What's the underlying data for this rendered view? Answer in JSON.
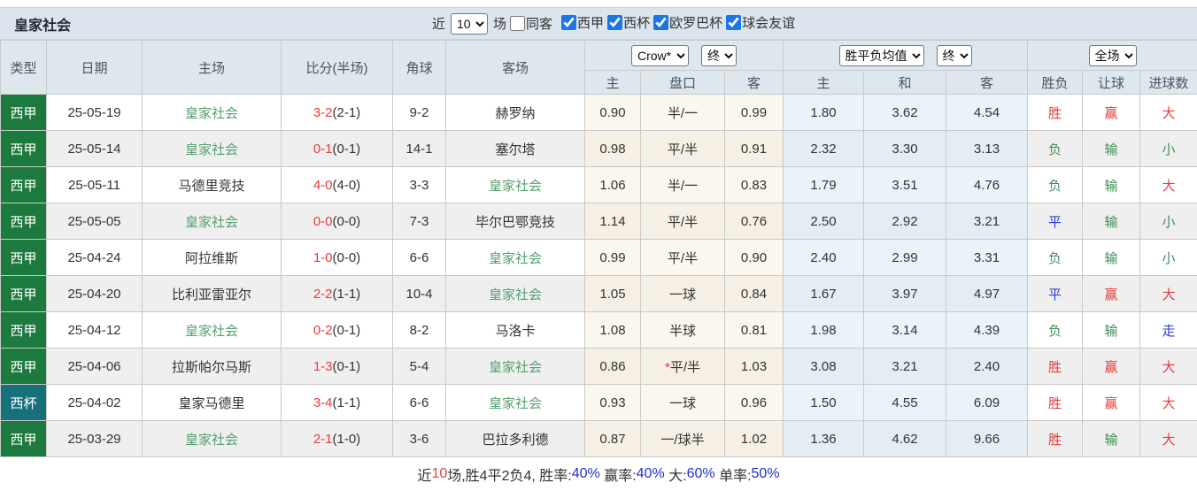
{
  "header": {
    "title": "皇家社会",
    "recent_label": "近",
    "recent_value": "10",
    "matches_label": "场",
    "same_venue_label": "同客",
    "leagues": [
      {
        "label": "西甲",
        "checked": true
      },
      {
        "label": "西杯",
        "checked": true
      },
      {
        "label": "欧罗巴杯",
        "checked": true
      },
      {
        "label": "球会友谊",
        "checked": true
      }
    ]
  },
  "table": {
    "columns": {
      "type": "类型",
      "date": "日期",
      "home": "主场",
      "score": "比分(半场)",
      "corner": "角球",
      "away": "客场"
    },
    "selects": {
      "bookmaker": "Crow*",
      "bookmaker_time": "终",
      "odds_mode": "胜平负均值",
      "odds_time": "终",
      "scope": "全场"
    },
    "sub_headers": {
      "ah_home": "主",
      "ah_line": "盘口",
      "ah_away": "客",
      "eu_home": "主",
      "eu_draw": "和",
      "eu_away": "客",
      "result": "胜负",
      "handicap": "让球",
      "goals": "进球数"
    },
    "rows": [
      {
        "league": "西甲",
        "comp": "liga",
        "date": "25-05-19",
        "home": "皇家社会",
        "home_hl": true,
        "score": "3-2",
        "half": "(2-1)",
        "corner": "9-2",
        "away": "赫罗纳",
        "away_hl": false,
        "ah": [
          "0.90",
          "半/一",
          "0.99"
        ],
        "star": false,
        "eu": [
          "1.80",
          "3.62",
          "4.54"
        ],
        "res": [
          "胜",
          "red"
        ],
        "hcp": [
          "赢",
          "red"
        ],
        "goal": [
          "大",
          "red"
        ]
      },
      {
        "league": "西甲",
        "comp": "liga",
        "date": "25-05-14",
        "home": "皇家社会",
        "home_hl": true,
        "score": "0-1",
        "half": "(0-1)",
        "corner": "14-1",
        "away": "塞尔塔",
        "away_hl": false,
        "ah": [
          "0.98",
          "平/半",
          "0.91"
        ],
        "star": false,
        "eu": [
          "2.32",
          "3.30",
          "3.13"
        ],
        "res": [
          "负",
          "green"
        ],
        "hcp": [
          "输",
          "green"
        ],
        "goal": [
          "小",
          "green"
        ]
      },
      {
        "league": "西甲",
        "comp": "liga",
        "date": "25-05-11",
        "home": "马德里竞技",
        "home_hl": false,
        "score": "4-0",
        "half": "(4-0)",
        "corner": "3-3",
        "away": "皇家社会",
        "away_hl": true,
        "ah": [
          "1.06",
          "半/一",
          "0.83"
        ],
        "star": false,
        "eu": [
          "1.79",
          "3.51",
          "4.76"
        ],
        "res": [
          "负",
          "green"
        ],
        "hcp": [
          "输",
          "green"
        ],
        "goal": [
          "大",
          "red"
        ]
      },
      {
        "league": "西甲",
        "comp": "liga",
        "date": "25-05-05",
        "home": "皇家社会",
        "home_hl": true,
        "score": "0-0",
        "half": "(0-0)",
        "corner": "7-3",
        "away": "毕尔巴鄂竞技",
        "away_hl": false,
        "ah": [
          "1.14",
          "平/半",
          "0.76"
        ],
        "star": false,
        "eu": [
          "2.50",
          "2.92",
          "3.21"
        ],
        "res": [
          "平",
          "blue"
        ],
        "hcp": [
          "输",
          "green"
        ],
        "goal": [
          "小",
          "green"
        ]
      },
      {
        "league": "西甲",
        "comp": "liga",
        "date": "25-04-24",
        "home": "阿拉维斯",
        "home_hl": false,
        "score": "1-0",
        "half": "(0-0)",
        "corner": "6-6",
        "away": "皇家社会",
        "away_hl": true,
        "ah": [
          "0.99",
          "平/半",
          "0.90"
        ],
        "star": false,
        "eu": [
          "2.40",
          "2.99",
          "3.31"
        ],
        "res": [
          "负",
          "green"
        ],
        "hcp": [
          "输",
          "green"
        ],
        "goal": [
          "小",
          "green"
        ]
      },
      {
        "league": "西甲",
        "comp": "liga",
        "date": "25-04-20",
        "home": "比利亚雷亚尔",
        "home_hl": false,
        "score": "2-2",
        "half": "(1-1)",
        "corner": "10-4",
        "away": "皇家社会",
        "away_hl": true,
        "ah": [
          "1.05",
          "一球",
          "0.84"
        ],
        "star": false,
        "eu": [
          "1.67",
          "3.97",
          "4.97"
        ],
        "res": [
          "平",
          "blue"
        ],
        "hcp": [
          "赢",
          "red"
        ],
        "goal": [
          "大",
          "red"
        ]
      },
      {
        "league": "西甲",
        "comp": "liga",
        "date": "25-04-12",
        "home": "皇家社会",
        "home_hl": true,
        "score": "0-2",
        "half": "(0-1)",
        "corner": "8-2",
        "away": "马洛卡",
        "away_hl": false,
        "ah": [
          "1.08",
          "半球",
          "0.81"
        ],
        "star": false,
        "eu": [
          "1.98",
          "3.14",
          "4.39"
        ],
        "res": [
          "负",
          "green"
        ],
        "hcp": [
          "输",
          "green"
        ],
        "goal": [
          "走",
          "blue"
        ]
      },
      {
        "league": "西甲",
        "comp": "liga",
        "date": "25-04-06",
        "home": "拉斯帕尔马斯",
        "home_hl": false,
        "score": "1-3",
        "half": "(0-1)",
        "corner": "5-4",
        "away": "皇家社会",
        "away_hl": true,
        "ah": [
          "0.86",
          "平/半",
          "1.03"
        ],
        "star": true,
        "eu": [
          "3.08",
          "3.21",
          "2.40"
        ],
        "res": [
          "胜",
          "red"
        ],
        "hcp": [
          "赢",
          "red"
        ],
        "goal": [
          "大",
          "red"
        ]
      },
      {
        "league": "西杯",
        "comp": "copa",
        "date": "25-04-02",
        "home": "皇家马德里",
        "home_hl": false,
        "score": "3-4",
        "half": "(1-1)",
        "corner": "6-6",
        "away": "皇家社会",
        "away_hl": true,
        "ah": [
          "0.93",
          "一球",
          "0.96"
        ],
        "star": false,
        "eu": [
          "1.50",
          "4.55",
          "6.09"
        ],
        "res": [
          "胜",
          "red"
        ],
        "hcp": [
          "赢",
          "red"
        ],
        "goal": [
          "大",
          "red"
        ]
      },
      {
        "league": "西甲",
        "comp": "liga",
        "date": "25-03-29",
        "home": "皇家社会",
        "home_hl": true,
        "score": "2-1",
        "half": "(1-0)",
        "corner": "3-6",
        "away": "巴拉多利德",
        "away_hl": false,
        "ah": [
          "0.87",
          "一/球半",
          "1.02"
        ],
        "star": false,
        "eu": [
          "1.36",
          "4.62",
          "9.66"
        ],
        "res": [
          "胜",
          "red"
        ],
        "hcp": [
          "输",
          "green"
        ],
        "goal": [
          "大",
          "red"
        ]
      }
    ]
  },
  "footer": {
    "parts": [
      {
        "text": "近",
        "color": "dark"
      },
      {
        "text": "10",
        "color": "red"
      },
      {
        "text": "场,胜4平2负4, 胜率:",
        "color": "dark"
      },
      {
        "text": "40%",
        "color": "blue"
      },
      {
        "text": " 赢率:",
        "color": "dark"
      },
      {
        "text": "40%",
        "color": "blue"
      },
      {
        "text": " 大:",
        "color": "dark"
      },
      {
        "text": "60%",
        "color": "blue"
      },
      {
        "text": " 单率:",
        "color": "dark"
      },
      {
        "text": "50%",
        "color": "blue"
      }
    ]
  },
  "colors": {
    "liga_green": "#1d7a3e",
    "copa_teal": "#17717b",
    "team_highlight_green": "#55a06e",
    "win_red": "#e93a3a",
    "lose_green": "#3e8e58",
    "draw_blue": "#2a3bd8",
    "header_bg": "#dee7ee",
    "ah_cream": "#fcf7ee",
    "eu_blue": "#eaf3f9"
  }
}
